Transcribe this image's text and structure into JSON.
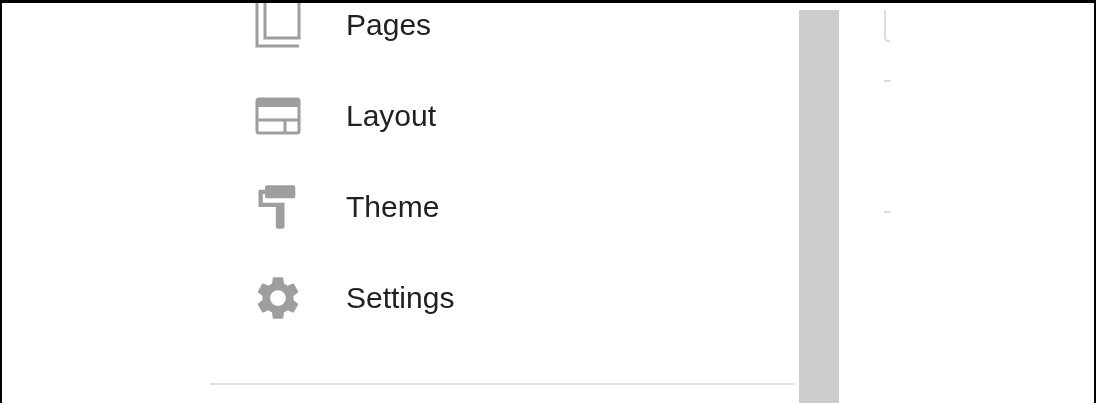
{
  "sidebar": {
    "items": [
      {
        "kind": "pages",
        "label": "Pages"
      },
      {
        "kind": "layout",
        "label": "Layout"
      },
      {
        "kind": "theme",
        "label": "Theme"
      },
      {
        "kind": "settings",
        "label": "Settings"
      }
    ]
  }
}
